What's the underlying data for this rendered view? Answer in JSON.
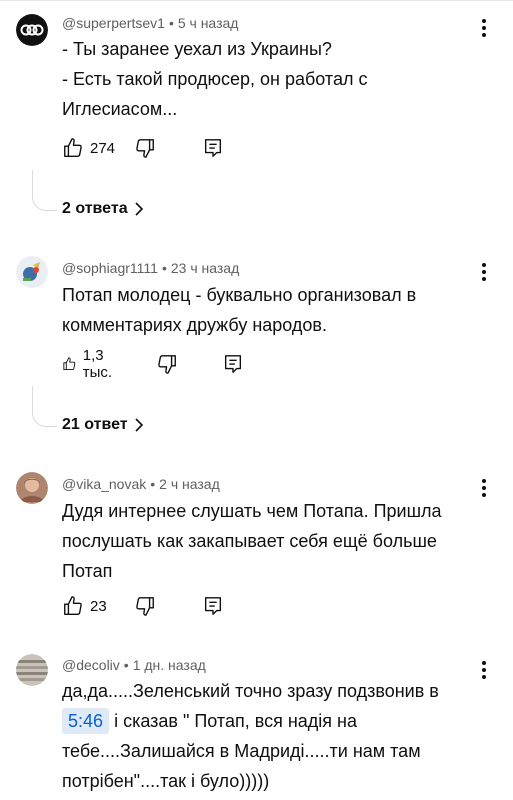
{
  "comments": [
    {
      "author": "@superpertsev1",
      "time": "5 ч назад",
      "lines": [
        "- Ты заранее уехал из Украины?",
        "- Есть такой продюсер, он работал с",
        "Иглесиасом..."
      ],
      "likes": "274",
      "replies": "2 ответа"
    },
    {
      "author": "@sophiagr1111",
      "time": "23 ч назад",
      "lines": [
        "Потап молодец - буквально организовал в",
        "комментариях дружбу народов."
      ],
      "likes": "1,3 тыс.",
      "replies": "21 ответ"
    },
    {
      "author": "@vika_novak",
      "time": "2 ч назад",
      "lines": [
        "Дудя интернее слушать чем Потапа. Пришла",
        "послушать как закапывает себя ещё больше",
        "Потап"
      ],
      "likes": "23"
    },
    {
      "author": "@decoliv",
      "time": "1 дн. назад",
      "line1": "да,да.....Зеленський точно зразу подзвонив в",
      "timestamp": "5:46",
      "line2_rest": "і сказав \" Потап, вся надія на",
      "line3": "тебе....Залишайся в Мадриді.....ти нам там",
      "line4": "потрібен\"....так і було)))))"
    }
  ],
  "meta_separator": "•",
  "icons": {
    "like": "thumb-up-icon",
    "dislike": "thumb-down-icon",
    "reply": "reply-icon",
    "more": "more-vertical-icon",
    "chevron": "chevron-right-icon"
  },
  "colors": {
    "meta_text": "#606060",
    "timestamp_bg": "#dfe9f8",
    "timestamp_text": "#065fd4"
  }
}
